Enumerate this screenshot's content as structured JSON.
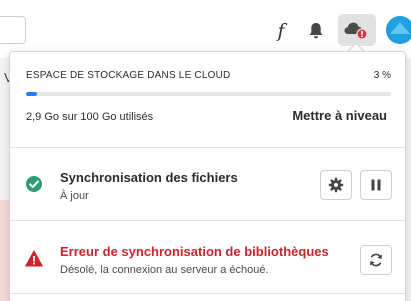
{
  "header": {
    "font_icon_glyph": "f",
    "icons": [
      "font-icon",
      "bell-icon",
      "cloud-error-icon",
      "avatar"
    ]
  },
  "background": {
    "partial_letter": "V"
  },
  "storage": {
    "heading": "ESPACE DE STOCKAGE DANS LE CLOUD",
    "percent_label": "3 %",
    "percent_value": 3,
    "used_text": "2,9 Go sur 100 Go utilisés",
    "upgrade_label": "Mettre à niveau"
  },
  "sync_files": {
    "title": "Synchronisation des fichiers",
    "status": "À jour",
    "icon": "check-circle-icon",
    "status_color": "#2d9d78",
    "buttons": [
      "gear-icon",
      "pause-icon"
    ]
  },
  "sync_libraries": {
    "title": "Erreur de synchronisation de bibliothèques",
    "message": "Désolé, la connexion au serveur a échoué.",
    "icon": "alert-triangle-icon",
    "error_color": "#c9252d",
    "buttons": [
      "refresh-icon"
    ]
  },
  "colors": {
    "accent": "#2680eb",
    "avatar": "#1f9ee0"
  }
}
